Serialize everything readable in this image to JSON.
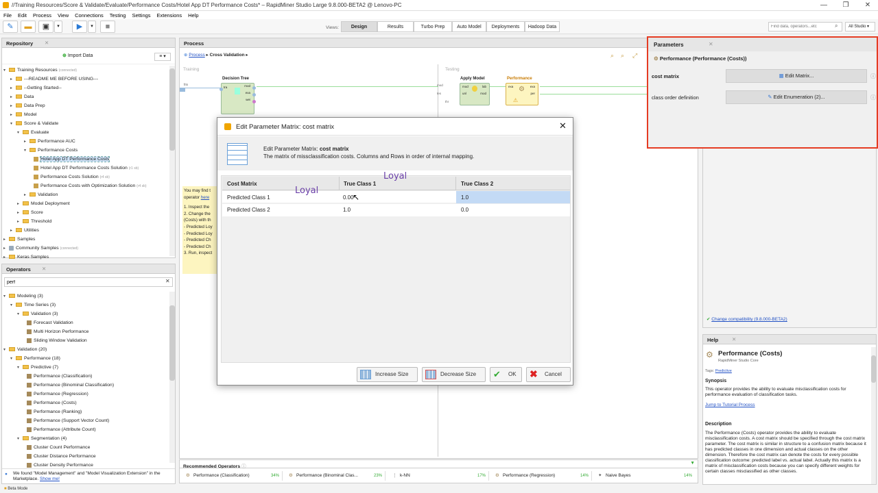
{
  "window": {
    "title": "//Training Resources/Score & Validate/Evaluate/Performance Costs/Hotel App DT Performance Costs* – RapidMiner Studio Large 9.8.000-BETA2 @ Lenovo-PC"
  },
  "menu": [
    "File",
    "Edit",
    "Process",
    "View",
    "Connections",
    "Testing",
    "Settings",
    "Extensions",
    "Help"
  ],
  "views": {
    "label": "Views:",
    "items": [
      "Design",
      "Results",
      "Turbo Prep",
      "Auto Model",
      "Deployments",
      "Hadoop Data"
    ],
    "active": "Design"
  },
  "search": {
    "placeholder": "Find data, operators...etc",
    "studio": "All Studio"
  },
  "repository": {
    "title": "Repository",
    "import": "Import Data",
    "items": [
      {
        "label": "Training Resources",
        "suffix": "(connected)"
      },
      {
        "label": "---README ME BEFORE USING---"
      },
      {
        "label": "--Getting Started--"
      },
      {
        "label": "Data"
      },
      {
        "label": "Data Prep"
      },
      {
        "label": "Model"
      },
      {
        "label": "Score & Validate"
      },
      {
        "label": "Evaluate"
      },
      {
        "label": "Performance AUC"
      },
      {
        "label": "Performance Costs"
      },
      {
        "label": "Hotel App DT Performance Costs"
      },
      {
        "label": "Hotel App DT Performance Costs Solution",
        "suffix": "(r1 sb)"
      },
      {
        "label": "Performance Costs Solution",
        "suffix": "(r4 sb)"
      },
      {
        "label": "Performance Costs with Optimization Solution",
        "suffix": "(r4 sb)"
      },
      {
        "label": "Validation"
      },
      {
        "label": "Model Deployment"
      },
      {
        "label": "Score"
      },
      {
        "label": "Threshold"
      },
      {
        "label": "Utilities"
      },
      {
        "label": "Samples"
      },
      {
        "label": "Community Samples",
        "suffix": "(connected)"
      },
      {
        "label": "Keras Samples"
      }
    ]
  },
  "operators": {
    "title": "Operators",
    "query": "perf",
    "items": [
      {
        "label": "Modeling (3)"
      },
      {
        "label": "Time Series (3)"
      },
      {
        "label": "Validation (3)"
      },
      {
        "label": "Forecast Validation"
      },
      {
        "label": "Multi Horizon Performance"
      },
      {
        "label": "Sliding Window Validation"
      },
      {
        "label": "Validation (20)"
      },
      {
        "label": "Performance (18)"
      },
      {
        "label": "Predictive (7)"
      },
      {
        "label": "Performance (Classification)"
      },
      {
        "label": "Performance (Binominal Classification)"
      },
      {
        "label": "Performance (Regression)"
      },
      {
        "label": "Performance (Costs)"
      },
      {
        "label": "Performance (Ranking)"
      },
      {
        "label": "Performance (Support Vector Count)"
      },
      {
        "label": "Performance (Attribute Count)"
      },
      {
        "label": "Segmentation (4)"
      },
      {
        "label": "Cluster Count Performance"
      },
      {
        "label": "Cluster Distance Performance"
      },
      {
        "label": "Cluster Density Performance"
      }
    ],
    "notice": "We found \"Model Management\" and \"Model Visualization Extension\" in the Marketplace.",
    "notice_link": "Show me!"
  },
  "beta": "Beta Mode",
  "process": {
    "title": "Process",
    "crumb_root": "Process",
    "crumb_child": "Cross Validation",
    "training": "Training",
    "testing": "Testing",
    "ops": {
      "tree": "Decision Tree",
      "apply": "Apply Model",
      "perf": "Performance"
    },
    "ports": {
      "tra": "tra",
      "mod": "mod",
      "exa": "exa",
      "wei": "wei",
      "unl": "unl",
      "lab": "lab",
      "per": "per",
      "tes": "tes",
      "thr": "thr"
    },
    "note": [
      "You may find t",
      "operator here",
      "",
      "1. Inspect the",
      "2. Change the",
      "(Costs) with th",
      "- Predicted Loy",
      "- Predicted Loy",
      "- Predicted Ch",
      "- Predicted Ch",
      "3. Run, inspect"
    ],
    "note_link": "here"
  },
  "recommended": {
    "title": "Recommended Operators",
    "items": [
      {
        "name": "Performance (Classification)",
        "pct": "34%"
      },
      {
        "name": "Performance (Binominal Clas...",
        "pct": "23%"
      },
      {
        "name": "k-NN",
        "pct": "17%"
      },
      {
        "name": "Performance (Regression)",
        "pct": "14%"
      },
      {
        "name": "Naive Bayes",
        "pct": "14%"
      }
    ]
  },
  "parameters": {
    "title": "Parameters",
    "operator": "Performance (Performance (Costs))",
    "rows": [
      {
        "label": "cost matrix",
        "button": "Edit Matrix..."
      },
      {
        "label": "class order definition",
        "button": "Edit Enumeration (2)..."
      }
    ],
    "compat": "Change compatibility (9.8.000-BETA2)"
  },
  "help": {
    "title": "Help",
    "op": "Performance (Costs)",
    "core": "RapidMiner Studio Core",
    "tags_label": "Tags:",
    "tag": "Predictive",
    "synopsis_h": "Synopsis",
    "synopsis": "This operator provides the ability to evaluate misclassification costs for performance evaluation of classification tasks.",
    "tutorial": "Jump to Tutorial Process",
    "desc_h": "Description",
    "desc": "The Performance (Costs) operator provides the ability to evaluate misclassification costs. A cost matrix should be specified through the cost matrix parameter. The cost matrix is similar in structure to a confusion matrix because it has predicted classes in one dimension and actual classes on the other dimension. Therefore the cost matrix can denote the costs for every possible classification outcome: predicted label vs. actual label. Actually this matrix is a matrix of misclassification costs because you can specify different weights for certain classes misclassified as other classes."
  },
  "dialog": {
    "title": "Edit Parameter Matrix: cost matrix",
    "heading_prefix": "Edit Parameter Matrix: ",
    "heading_bold": "cost matrix",
    "desc": "The matrix of missclassification costs. Columns and Rows in order of internal mapping.",
    "corner": "Cost Matrix",
    "cols": [
      "True Class 1",
      "True Class 2"
    ],
    "rows": [
      {
        "label": "Predicted Class 1",
        "cells": [
          "0.00",
          "1.0"
        ]
      },
      {
        "label": "Predicted Class 2",
        "cells": [
          "1.0",
          "0.0"
        ]
      }
    ],
    "annot1": "Loyal",
    "annot2": "Loyal",
    "buttons": {
      "increase": "Increase Size",
      "decrease": "Decrease Size",
      "ok": "OK",
      "cancel": "Cancel"
    }
  }
}
